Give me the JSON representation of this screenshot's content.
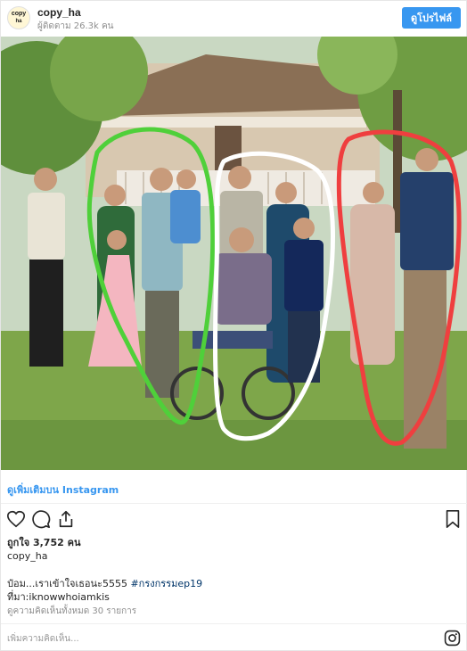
{
  "header": {
    "avatar_line1": "copy",
    "avatar_line2": "ha",
    "username": "copy_ha",
    "followers": "ผู้ติดตาม 26.3k คน",
    "profile_button": "ดูโปรไฟล์"
  },
  "post": {
    "view_more": "ดูเพิ่มเติมบน Instagram",
    "likes": "ถูกใจ 3,752 คน",
    "caption_user": "copy_ha",
    "caption_text": "ป๋อม...เราเข้าใจเธอนะ5555 ",
    "caption_hashtag": "#กรงกรรมep19",
    "source": "ที่มา:iknowwhoiamkis",
    "comments_link": "ดูความคิดเห็นทั้งหมด 30 รายการ",
    "comment_placeholder": "เพิ่มความคิดเห็น..."
  },
  "icons": {
    "like": "heart-icon",
    "comment": "comment-icon",
    "share": "share-icon",
    "save": "bookmark-icon",
    "logo": "instagram-icon"
  },
  "colors": {
    "accent": "#3897f0",
    "hashtag": "#003569",
    "circle_green": "#4fd03a",
    "circle_white": "#ffffff",
    "circle_red": "#ef3f3f"
  }
}
